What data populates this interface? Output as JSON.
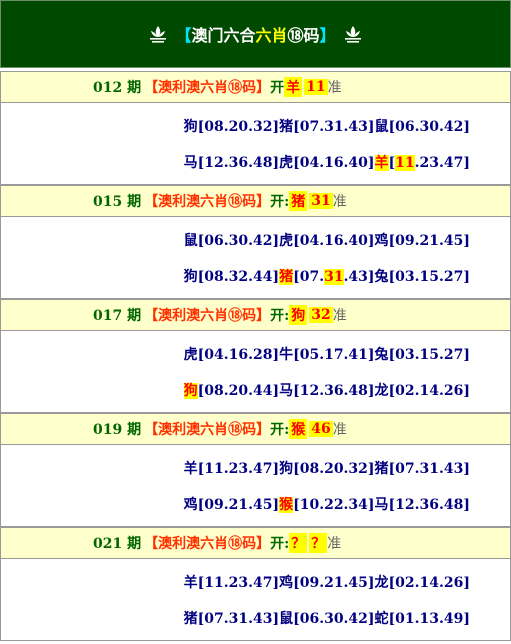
{
  "header": {
    "bracket_left": "【",
    "title_part1": "澳门六合",
    "title_part2": "六肖",
    "title_part3": "⑱码",
    "bracket_right": "】"
  },
  "sections": [
    {
      "issue": "012 期",
      "brand": "【澳利澳六肖⑱码】",
      "kai": "开",
      "result_zodiac": "羊",
      "result_number": "11",
      "zhun": "准",
      "line1": [
        {
          "t": "狗[08.20.32]"
        },
        {
          "t": "猪[07.31.43]"
        },
        {
          "t": "鼠[06.30.42]"
        }
      ],
      "line2": [
        {
          "t": "马[12.36.48]"
        },
        {
          "t": "虎[04.16.40]"
        },
        {
          "t": "羊",
          "hl": true
        },
        {
          "t": "["
        },
        {
          "t": "11",
          "hl": true
        },
        {
          "t": ".23.47]"
        }
      ]
    },
    {
      "issue": "015 期",
      "brand": "【澳利澳六肖⑱码】",
      "kai": "开:",
      "result_zodiac": "猪",
      "result_number": "31",
      "zhun": "准",
      "line1": [
        {
          "t": "鼠[06.30.42]"
        },
        {
          "t": "虎[04.16.40]"
        },
        {
          "t": "鸡[09.21.45]"
        }
      ],
      "line2": [
        {
          "t": "狗[08.32.44]"
        },
        {
          "t": "猪",
          "hl": true
        },
        {
          "t": "[07."
        },
        {
          "t": "31",
          "hl": true
        },
        {
          "t": ".43]"
        },
        {
          "t": "兔[03.15.27]"
        }
      ]
    },
    {
      "issue": "017 期",
      "brand": "【澳利澳六肖⑱码】",
      "kai": "开:",
      "result_zodiac": "狗",
      "result_number": "32",
      "zhun": "准",
      "line1": [
        {
          "t": "虎[04.16.28]"
        },
        {
          "t": "牛[05.17.41]"
        },
        {
          "t": "兔[03.15.27]"
        }
      ],
      "line2": [
        {
          "t": "狗",
          "hl": true
        },
        {
          "t": "[08.20.44]"
        },
        {
          "t": "马[12.36.48]"
        },
        {
          "t": "龙[02.14.26]"
        }
      ]
    },
    {
      "issue": "019 期",
      "brand": "【澳利澳六肖⑱码】",
      "kai": "开:",
      "result_zodiac": "猴",
      "result_number": "46",
      "zhun": "准",
      "line1": [
        {
          "t": "羊[11.23.47]"
        },
        {
          "t": "狗[08.20.32]"
        },
        {
          "t": "猪[07.31.43]"
        }
      ],
      "line2": [
        {
          "t": "鸡[09.21.45]"
        },
        {
          "t": "猴",
          "hl": true
        },
        {
          "t": "[10.22.34]"
        },
        {
          "t": "马[12.36.48]"
        }
      ]
    },
    {
      "issue": "021 期",
      "brand": "【澳利澳六肖⑱码】",
      "kai": "开:",
      "result_zodiac": "？",
      "result_number": "？",
      "zhun": "准",
      "line1": [
        {
          "t": "羊[11.23.47]"
        },
        {
          "t": "鸡[09.21.45]"
        },
        {
          "t": "龙[02.14.26]"
        }
      ],
      "line2": [
        {
          "t": "猪[07.31.43]"
        },
        {
          "t": "鼠[06.30.42]"
        },
        {
          "t": "蛇[01.13.49]"
        }
      ]
    }
  ]
}
